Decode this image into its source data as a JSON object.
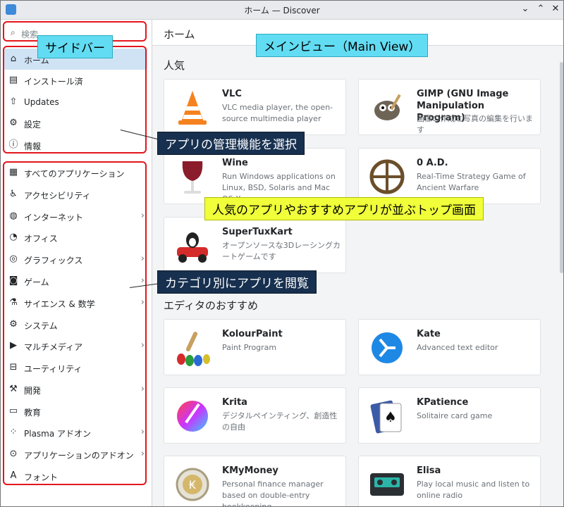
{
  "window": {
    "title": "ホーム — Discover"
  },
  "sidebar": {
    "search_placeholder": "検索",
    "items": [
      {
        "label": "ホーム",
        "icon": "home-icon",
        "glyph": "⌂",
        "chevron": false
      },
      {
        "label": "インストール済",
        "icon": "installed-icon",
        "glyph": "▤",
        "chevron": false
      },
      {
        "label": "Updates",
        "icon": "updates-icon",
        "glyph": "⇧",
        "chevron": false
      },
      {
        "label": "設定",
        "icon": "settings-icon",
        "glyph": "⚙",
        "chevron": false
      },
      {
        "label": "情報",
        "icon": "info-icon",
        "glyph": "ⓘ",
        "chevron": false
      },
      {
        "label": "すべてのアプリケーション",
        "icon": "all-apps-icon",
        "glyph": "▦",
        "chevron": false
      },
      {
        "label": "アクセシビリティ",
        "icon": "accessibility-icon",
        "glyph": "♿",
        "chevron": false
      },
      {
        "label": "インターネット",
        "icon": "globe-icon",
        "glyph": "◍",
        "chevron": true
      },
      {
        "label": "オフィス",
        "icon": "office-icon",
        "glyph": "◔",
        "chevron": false
      },
      {
        "label": "グラフィックス",
        "icon": "graphics-icon",
        "glyph": "◎",
        "chevron": true
      },
      {
        "label": "ゲーム",
        "icon": "gamepad-icon",
        "glyph": "◙",
        "chevron": true
      },
      {
        "label": "サイエンス & 数学",
        "icon": "flask-icon",
        "glyph": "⚗",
        "chevron": true
      },
      {
        "label": "システム",
        "icon": "gear-icon",
        "glyph": "⚙",
        "chevron": false
      },
      {
        "label": "マルチメディア",
        "icon": "multimedia-icon",
        "glyph": "▶",
        "chevron": true
      },
      {
        "label": "ユーティリティ",
        "icon": "toolbox-icon",
        "glyph": "⊟",
        "chevron": false
      },
      {
        "label": "開発",
        "icon": "hammer-icon",
        "glyph": "⚒",
        "chevron": true
      },
      {
        "label": "教育",
        "icon": "education-icon",
        "glyph": "▭",
        "chevron": false
      },
      {
        "label": "Plasma アドオン",
        "icon": "plasma-icon",
        "glyph": "⁘",
        "chevron": true
      },
      {
        "label": "アプリケーションのアドオン",
        "icon": "addons-icon",
        "glyph": "⊙",
        "chevron": true
      },
      {
        "label": "フォント",
        "icon": "font-icon",
        "glyph": "A",
        "chevron": false
      }
    ]
  },
  "main": {
    "header_title": "ホーム",
    "sections": [
      {
        "title": "人気",
        "apps": [
          {
            "name": "VLC",
            "description": "VLC media player, the open-source multimedia player",
            "icon": "vlc-icon"
          },
          {
            "name": "GIMP (GNU Image Manipulation Program)",
            "description": "画像の作成と写真の編集を行います",
            "icon": "gimp-icon"
          },
          {
            "name": "Wine",
            "description": "Run Windows applications on Linux, BSD, Solaris and Mac OS X",
            "icon": "wine-icon"
          },
          {
            "name": "0 A.D.",
            "description": "Real-Time Strategy Game of Ancient Warfare",
            "icon": "0ad-icon"
          },
          {
            "name": "SuperTuxKart",
            "description": "オープンソースな3Dレーシングカートゲームです",
            "icon": "supertuxkart-icon"
          }
        ]
      },
      {
        "title": "エディタのおすすめ",
        "apps": [
          {
            "name": "KolourPaint",
            "description": "Paint Program",
            "icon": "kolourpaint-icon"
          },
          {
            "name": "Kate",
            "description": "Advanced text editor",
            "icon": "kate-icon"
          },
          {
            "name": "Krita",
            "description": "デジタルペインティング、創造性の自由",
            "icon": "krita-icon"
          },
          {
            "name": "KPatience",
            "description": "Solitaire card game",
            "icon": "kpatience-icon"
          },
          {
            "name": "KMyMoney",
            "description": "Personal finance manager based on double-entry bookkeeping",
            "icon": "kmymoney-icon"
          },
          {
            "name": "Elisa",
            "description": "Play local music and listen to online radio",
            "icon": "elisa-icon"
          }
        ]
      }
    ]
  },
  "annotations": {
    "sidebar_label": "サイドバー",
    "main_view_label": "メインビュー（Main View）",
    "manage_label": "アプリの管理機能を選択",
    "top_screen_label": "人気のアプリやおすすめアプリが並ぶトップ画面",
    "category_label": "カテゴリ別にアプリを閲覧"
  },
  "colors": {
    "accent": "#3daee9",
    "highlight": "#e3161d",
    "active_bg": "#cfe3f5"
  }
}
